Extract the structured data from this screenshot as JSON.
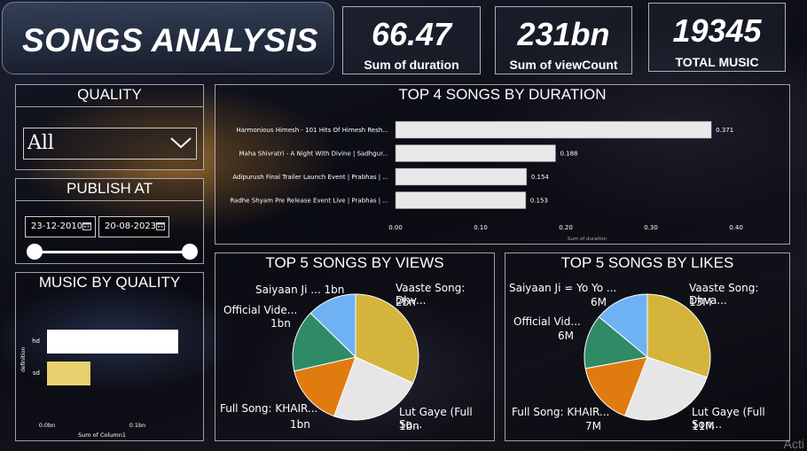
{
  "header": {
    "title": "SONGS ANALYSIS"
  },
  "kpis": [
    {
      "value": "66.47",
      "label": "Sum of duration"
    },
    {
      "value": "231bn",
      "label": "Sum of viewCount"
    },
    {
      "value": "19345",
      "label": "TOTAL MUSIC"
    }
  ],
  "quality_filter": {
    "title": "QUALITY",
    "selected": "All"
  },
  "publish_filter": {
    "title": "PUBLISH AT",
    "start": "23-12-2010",
    "end": "20-08-2023"
  },
  "quality_chart": {
    "title": "MUSIC BY QUALITY",
    "ylabel": "definition",
    "xlabel": "Sum of Column1",
    "ticks": [
      "0.0bn",
      "0.1bn"
    ]
  },
  "duration_chart": {
    "title": "TOP 4 SONGS BY DURATION",
    "xlabel": "Sum of duration",
    "ticks": [
      "0.00",
      "0.10",
      "0.20",
      "0.30",
      "0.40"
    ]
  },
  "views_chart": {
    "title": "TOP 5 SONGS BY VIEWS"
  },
  "likes_chart": {
    "title": "TOP 5 SONGS BY LIKES"
  },
  "colors": {
    "gold": "#d4b43a",
    "light": "#e6e6e6",
    "orange": "#e07b10",
    "green": "#2f8a66",
    "blue": "#6eb2f4",
    "bar": "#e8e8e8",
    "sd": "#e8d070"
  },
  "watermark": "Acti",
  "chart_data": [
    {
      "type": "bar",
      "orientation": "horizontal",
      "title": "TOP 4 SONGS BY DURATION",
      "xlabel": "Sum of duration",
      "xlim": [
        0,
        0.42
      ],
      "categories": [
        "Harmonious Himesh - 101 Hits Of Himesh Resh...",
        "Maha Shivratri - A Night With Divine | Sadhgur...",
        "Adipurush Final Trailer Launch Event | Prabhas | ...",
        "Radhe Shyam Pre Release Event Live | Prabhas | ..."
      ],
      "values": [
        0.371,
        0.188,
        0.154,
        0.153
      ],
      "data_labels": [
        "0.371",
        "0.188",
        "0.154",
        "0.153"
      ]
    },
    {
      "type": "bar",
      "orientation": "horizontal",
      "title": "MUSIC BY QUALITY",
      "xlabel": "Sum of Column1",
      "ylabel": "definition",
      "categories": [
        "hd",
        "sd"
      ],
      "values": [
        0.145,
        0.048
      ],
      "unit": "bn",
      "xlim": [
        0,
        0.15
      ]
    },
    {
      "type": "pie",
      "title": "TOP 5 SONGS BY VIEWS",
      "labels": [
        "Vaaste Song: Dhv...",
        "Lut Gaye (Full So...",
        "Full Song: KHAIR...",
        "Official Vide...",
        "Saiyaan Ji ... 1bn"
      ],
      "values": [
        2,
        1.5,
        1,
        1,
        0.8
      ],
      "value_labels": [
        "2bn",
        "1bn",
        "1bn",
        "1bn",
        ""
      ],
      "colors": [
        "#d4b43a",
        "#e6e6e6",
        "#e07b10",
        "#2f8a66",
        "#6eb2f4"
      ]
    },
    {
      "type": "pie",
      "title": "TOP 5 SONGS BY LIKES",
      "labels": [
        "Vaaste Song: Dhva...",
        "Lut Gaye (Full Son...",
        "Full Song: KHAIR...",
        "Official Vid...",
        "Saiyaan Ji ⋍ Yo Yo ..."
      ],
      "values": [
        13,
        11,
        7,
        6,
        6
      ],
      "value_labels": [
        "13M",
        "11M",
        "7M",
        "6M",
        "6M"
      ],
      "colors": [
        "#d4b43a",
        "#e6e6e6",
        "#e07b10",
        "#2f8a66",
        "#6eb2f4"
      ]
    }
  ]
}
